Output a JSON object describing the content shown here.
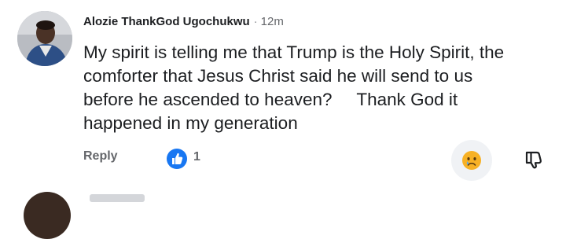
{
  "comment": {
    "author": "Alozie ThankGod Ugochukwu",
    "separator": "·",
    "time": "12m",
    "body": "My spirit is telling me that Trump is the Holy Spirit, the\ncomforter that Jesus Christ said he will send to us\nbefore he ascended to heaven?     Thank God it\nhappened in my generation",
    "reply_label": "Reply",
    "like_count": "1",
    "reaction": "sad-face-icon"
  },
  "colors": {
    "like_blue": "#1877f2",
    "muted_text": "#65676b",
    "reaction_yellow": "#f7b125"
  }
}
